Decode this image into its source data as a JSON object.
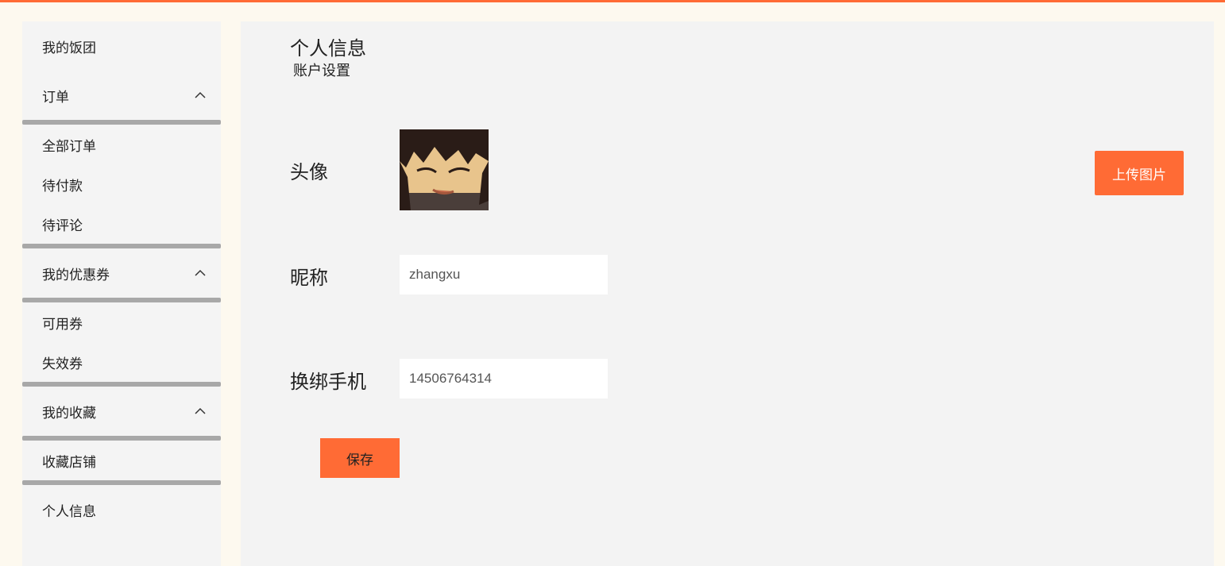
{
  "sidebar": {
    "my_group": "我的饭团",
    "orders": {
      "label": "订单",
      "items": [
        "全部订单",
        "待付款",
        "待评论"
      ]
    },
    "coupons": {
      "label": "我的优惠券",
      "items": [
        "可用券",
        "失效券"
      ]
    },
    "favorites": {
      "label": "我的收藏",
      "items": [
        "收藏店铺"
      ]
    },
    "profile": "个人信息"
  },
  "main": {
    "title": "个人信息",
    "subtitle": "账户设置",
    "avatar_label": "头像",
    "upload_button": "上传图片",
    "nickname_label": "昵称",
    "nickname_value": "zhangxu",
    "phone_label": "换绑手机",
    "phone_value": "14506764314",
    "save_button": "保存"
  },
  "colors": {
    "accent": "#ff6b35",
    "page_background": "#fdf9ef",
    "panel_background": "#f3f3f3"
  },
  "icons": {
    "collapse": "chevron-up-icon"
  }
}
